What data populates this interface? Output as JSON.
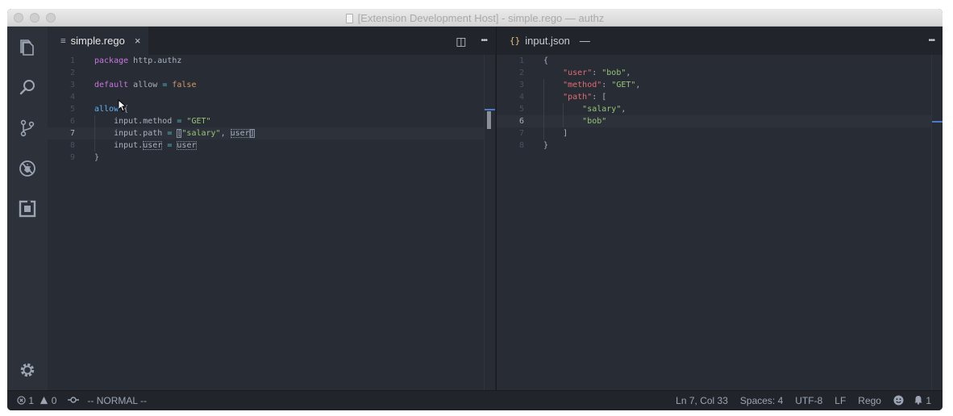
{
  "titlebar": {
    "title": "[Extension Development Host] - simple.rego — authz"
  },
  "activity_bar": {
    "items": [
      "explorer-icon",
      "search-icon",
      "source-control-icon",
      "debug-icon",
      "extensions-icon"
    ],
    "bottom": "settings-gear-icon"
  },
  "left_editor": {
    "tab": {
      "label": "simple.rego",
      "icon": "≡",
      "close": "×"
    },
    "actions": {
      "split": "◫",
      "more": "•••"
    },
    "current_line": 7,
    "lines": [
      {
        "n": "1",
        "t": [
          [
            "kw",
            "package"
          ],
          [
            "p",
            " http.authz"
          ]
        ]
      },
      {
        "n": "2",
        "t": []
      },
      {
        "n": "3",
        "t": [
          [
            "kw",
            "default"
          ],
          [
            "p",
            " allow "
          ],
          [
            "op",
            "="
          ],
          [
            "p",
            " "
          ],
          [
            "num",
            "false"
          ]
        ]
      },
      {
        "n": "4",
        "t": []
      },
      {
        "n": "5",
        "t": [
          [
            "blue",
            "allow"
          ],
          [
            "p",
            " {"
          ]
        ]
      },
      {
        "n": "6",
        "t": [
          [
            "p",
            "    input.method "
          ],
          [
            "op",
            "="
          ],
          [
            "p",
            " "
          ],
          [
            "str",
            "\"GET\""
          ]
        ]
      },
      {
        "n": "7",
        "t": [
          [
            "p",
            "    input.path "
          ],
          [
            "op",
            "="
          ],
          [
            "p",
            " "
          ],
          [
            "bracket",
            "["
          ],
          [
            "str",
            "\"salary\""
          ],
          [
            "p",
            ", "
          ],
          [
            "box",
            "user"
          ],
          [
            "bracket",
            "]"
          ]
        ]
      },
      {
        "n": "8",
        "t": [
          [
            "p",
            "    input."
          ],
          [
            "box",
            "user"
          ],
          [
            "p",
            " "
          ],
          [
            "op",
            "="
          ],
          [
            "p",
            " "
          ],
          [
            "box",
            "user"
          ]
        ]
      },
      {
        "n": "9",
        "t": [
          [
            "p",
            "}"
          ]
        ]
      }
    ]
  },
  "right_editor": {
    "tab": {
      "label": "input.json",
      "icon": "{}",
      "close": "—"
    },
    "actions": {
      "more": "•••"
    },
    "current_line": 6,
    "lines": [
      {
        "n": "1",
        "t": [
          [
            "p",
            "{"
          ]
        ]
      },
      {
        "n": "2",
        "t": [
          [
            "p",
            "    "
          ],
          [
            "key",
            "\"user\""
          ],
          [
            "p",
            ": "
          ],
          [
            "str",
            "\"bob\""
          ],
          [
            "p",
            ","
          ]
        ]
      },
      {
        "n": "3",
        "t": [
          [
            "p",
            "    "
          ],
          [
            "key",
            "\"method\""
          ],
          [
            "p",
            ": "
          ],
          [
            "str",
            "\"GET\""
          ],
          [
            "p",
            ","
          ]
        ]
      },
      {
        "n": "4",
        "t": [
          [
            "p",
            "    "
          ],
          [
            "key",
            "\"path\""
          ],
          [
            "p",
            ": ["
          ]
        ]
      },
      {
        "n": "5",
        "t": [
          [
            "p",
            "        "
          ],
          [
            "str",
            "\"salary\""
          ],
          [
            "p",
            ","
          ]
        ]
      },
      {
        "n": "6",
        "t": [
          [
            "p",
            "        "
          ],
          [
            "str",
            "\"bob\""
          ]
        ]
      },
      {
        "n": "7",
        "t": [
          [
            "p",
            "    ]"
          ]
        ]
      },
      {
        "n": "8",
        "t": [
          [
            "p",
            "}"
          ]
        ]
      }
    ]
  },
  "statusbar": {
    "errors": "1",
    "warnings": "0",
    "mode": "-- NORMAL --",
    "position": "Ln 7, Col 33",
    "spaces": "Spaces: 4",
    "encoding": "UTF-8",
    "eol": "LF",
    "language": "Rego",
    "notifications": "1"
  }
}
